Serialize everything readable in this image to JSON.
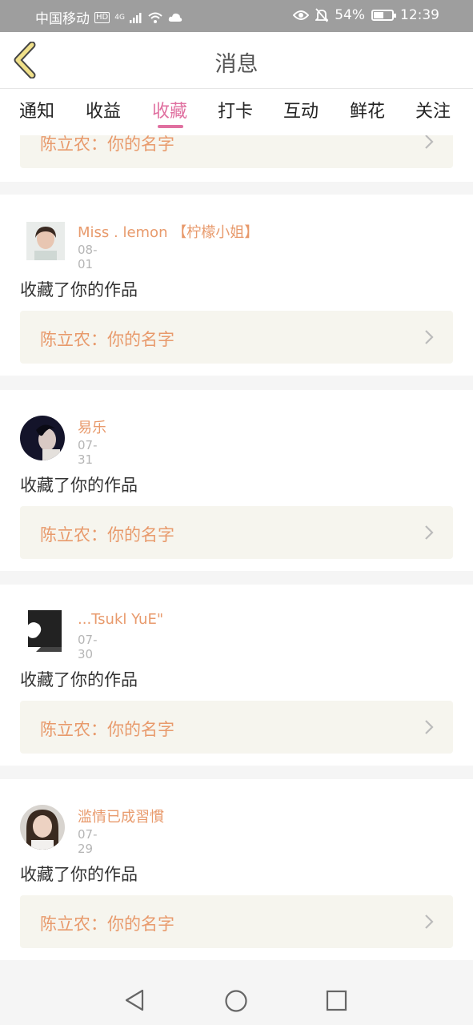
{
  "status_bar": {
    "carrier": "中国移动",
    "hd": "HD",
    "network": "4G",
    "battery_percent": "54%",
    "battery_level": 0.54,
    "time": "12:39"
  },
  "header": {
    "title": "消息",
    "back_icon": "chevron-left-icon"
  },
  "tabs": [
    {
      "label": "通知",
      "active": false
    },
    {
      "label": "收益",
      "active": false
    },
    {
      "label": "收藏",
      "active": true
    },
    {
      "label": "打卡",
      "active": false
    },
    {
      "label": "互动",
      "active": false
    },
    {
      "label": "鲜花",
      "active": false
    },
    {
      "label": "关注",
      "active": false
    }
  ],
  "partial_card": {
    "work_title": "陈立农：你的名字"
  },
  "items": [
    {
      "username": "Miss . lemon 【柠檬小姐】",
      "date": "08-01",
      "action": "收藏了你的作品",
      "work_title": "陈立农：你的名字"
    },
    {
      "username": "易乐",
      "date": "07-31",
      "action": "收藏了你的作品",
      "work_title": "陈立农：你的名字"
    },
    {
      "username": "...Tsukl YuE\"",
      "date": "07-30",
      "action": "收藏了你的作品",
      "work_title": "陈立农：你的名字"
    },
    {
      "username": "滥情已成習慣",
      "date": "07-29",
      "action": "收藏了你的作品",
      "work_title": "陈立农：你的名字"
    }
  ],
  "colors": {
    "accent": "#e070a0",
    "name": "#e89a6c",
    "link_bg": "#f6f5ee",
    "back_arrow": "#f0e08a"
  }
}
